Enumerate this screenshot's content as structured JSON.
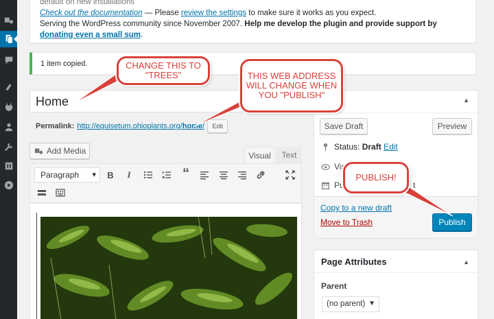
{
  "notice": {
    "line1": "default on new installations",
    "doc_link": "Check out the documentation",
    "mid_text": " — Please ",
    "settings_link": "review the settings",
    "end_text": " to make sure it works as you expect.",
    "serving": "Serving the WordPress community since November 2007. ",
    "help": "Help me develop the plugin and provide support by ",
    "donate_link": "donating even a small sum",
    "period": "."
  },
  "copied_notice": "1 item copied.",
  "post": {
    "title": "Home",
    "permalink_label": "Permalink:",
    "permalink_base": "http://equisetum.ohioplants.org/",
    "permalink_slug": "home",
    "permalink_trail": "/",
    "edit_label": "Edit"
  },
  "editor": {
    "add_media": "Add Media",
    "tab_visual": "Visual",
    "tab_text": "Text",
    "format": "Paragraph",
    "bold": "B",
    "italic": "I",
    "quote": "“"
  },
  "publish": {
    "header_tail": "h",
    "save_draft": "Save Draft",
    "preview": "Preview",
    "status_label": "Status:",
    "status_value": "Draft",
    "status_edit": "Edit",
    "visibility_partial": "Vis",
    "schedule_partial": "Pu",
    "schedule_tail": "t",
    "copy_draft": "Copy to a new draft",
    "trash": "Move to Trash",
    "publish": "Publish"
  },
  "attributes": {
    "title": "Page Attributes",
    "parent_label": "Parent",
    "parent_value": "(no parent)"
  },
  "annotations": {
    "title_callout": "CHANGE THIS TO \"TREES\"",
    "url_callout": "THIS WEB ADDRESS WILL CHANGE WHEN YOU \"PUBLISH\"",
    "publish_callout": "PUBLISH!"
  },
  "colors": {
    "admin_bar": "#23282d",
    "accent": "#0073aa",
    "publish_button": "#0085ba",
    "success": "#46b450",
    "annotation": "#d9413a",
    "trash": "#aa0000"
  }
}
